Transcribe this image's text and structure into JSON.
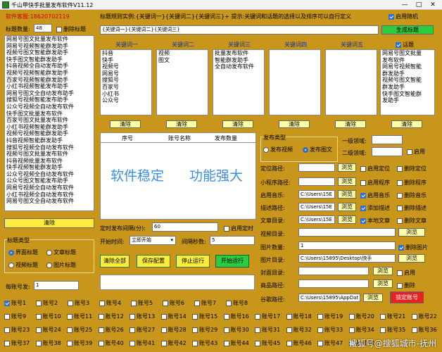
{
  "window": {
    "title": "千山甲快手批量发布软件V11.12",
    "minimize": "—",
    "maximize": "□",
    "close": "✕"
  },
  "header": {
    "customer_service": "软件客服:18620702119",
    "title_rule": "标题规则实例:{关键词一}{关键词二}{关键词三}+ 提示:关键词和话题的选择以及排序可以自行定义",
    "enable_random": "启用随机",
    "title_template": "{关键词一}{关键词二}{关键词三}",
    "generate_title": "生成标题",
    "title_count_label": "标题数量:",
    "title_count_value": "48",
    "delete_title": "删除标题"
  },
  "title_list": [
    "网易号图文批量发布软件",
    "网易号视频智能群发助手",
    "视频号图文智能群发助手",
    "快手图文智能群发助手",
    "抖音视频全自动发布助手",
    "视频号视频智能群发助手",
    "百家号视频智能群发助手",
    "小红书视频智能发布助手",
    "网易号图文全自动发布助手",
    "搜狐号视频智能发布助手",
    "公众号视频全自动发布软件",
    "快手图文批量发布软件",
    "百家号图文批量发布软件",
    "小红书视频智能群发助手",
    "视频号视频智能群发助手",
    "抖音视频智能群发助手",
    "搜狐号视频全自动发布软件",
    "视频号图文批量发布软件",
    "抖音视频批量发布软件",
    "快手视频智能群发助手",
    "公众号视频全自动发布软件",
    "公众号图文智能发布助手",
    "网易号视频全自动发布软件",
    "小红书视频全自动发布软件",
    "网易号图文全自动发布软件"
  ],
  "keyword_cols": [
    {
      "title": "关键词一",
      "items": [
        "抖音",
        "快手",
        "视频号",
        "网易号",
        "搜狐号",
        "百家号",
        "小红书",
        "公众号"
      ],
      "clear": "清除"
    },
    {
      "title": "关键词二",
      "items": [
        "视频",
        "图文"
      ],
      "clear": "清除"
    },
    {
      "title": "关键词三",
      "items": [
        "批量发布软件",
        "智能群发助手",
        "全自动发布软件"
      ],
      "clear": "清除"
    },
    {
      "title": "关键词四",
      "items": [],
      "clear": "清除"
    },
    {
      "title": "关键词五",
      "items": [],
      "clear": "清除"
    }
  ],
  "topic": {
    "label": "话题",
    "items": [
      "网易号图文批量",
      "发布软件",
      "网易号视频智能",
      "群发助手",
      "视频号图文智能",
      "群发助手",
      "快手图文智能群",
      "发助手"
    ],
    "clear": "清除"
  },
  "clear_left": "清除",
  "grid": {
    "col_index": "序号",
    "col_account": "账号名称",
    "col_count": "发布数量",
    "banner1": "软件稳定",
    "banner2": "功能强大"
  },
  "title_type": {
    "label": "标题类型",
    "options": [
      "界面标题",
      "文章标题",
      "视频标题",
      "图片标题"
    ]
  },
  "per_account": {
    "label": "每账号发:",
    "value": "1"
  },
  "timing": {
    "interval_label": "定时发布间隔(分):",
    "interval_value": "60",
    "enable_timing": "启用定时",
    "start_label": "开始时间:",
    "start_value": "立即开始",
    "gap_label": "间隔秒数:",
    "gap_value": "5"
  },
  "actions": {
    "clear_all": "清除全部",
    "save": "保存配置",
    "stop": "停止运行",
    "start": "开始运行"
  },
  "publish_type": {
    "label": "发布类型",
    "video": "发布视频",
    "image": "发布图文"
  },
  "right_panel": {
    "domain1": "一级领域:",
    "domain2": "二级领域:",
    "enable": "启用",
    "location": "定位路径:",
    "enable_location": "启用定位",
    "delete_location": "删除定位",
    "mini_prog": "小程序路径:",
    "enable_mini": "启用程序",
    "delete_mini": "删除程序",
    "music": "启用音乐:",
    "music_path": "C:\\Users\\15E",
    "enable_music": "启用音乐",
    "delete_music": "删除音乐",
    "desc": "描述路径:",
    "desc_path": "C:\\Users\\15E",
    "add_desc": "添加描述",
    "delete_desc": "删除描述",
    "article": "文章目录:",
    "article_path": "C:\\Users\\15E",
    "local_article": "本地文章",
    "delete_article": "删除文章",
    "video_dir": "视频目录:",
    "img_count": "图片数量:",
    "img_count_value": "1",
    "delete_img": "删除图片",
    "img_dir": "图片目录:",
    "img_dir_path": "C:\\Users\\15895\\Desktop\\快手",
    "cover_dir": "封面目录:",
    "enable_cover": "启用",
    "goods_path": "商品路径:",
    "delete_goods": "删除",
    "chrome": "谷歌路径:",
    "chrome_path": "C:\\Users\\15895\\AppDat",
    "lock_account": "锁定账号",
    "browse": "浏览"
  },
  "accounts": [
    "账号1",
    "账号2",
    "账号3",
    "账号4",
    "账号5",
    "账号6",
    "账号7",
    "账号8",
    "账号9",
    "账号10",
    "账号11",
    "账号12",
    "账号13",
    "账号14",
    "账号15",
    "账号16",
    "账号17",
    "账号18",
    "账号19",
    "账号20",
    "账号21",
    "账号22",
    "账号23",
    "账号24",
    "账号25",
    "账号26",
    "账号27",
    "账号28",
    "账号29",
    "账号30",
    "账号31",
    "账号32",
    "账号33",
    "账号34",
    "账号35",
    "账号36",
    "账号37",
    "账号38",
    "账号39",
    "账号40",
    "账号41",
    "账号42",
    "账号43",
    "账号44",
    "账号45",
    "账号46",
    "账号47",
    "账号48"
  ],
  "watermark": "搜狐号@搜狐城市-抚州"
}
